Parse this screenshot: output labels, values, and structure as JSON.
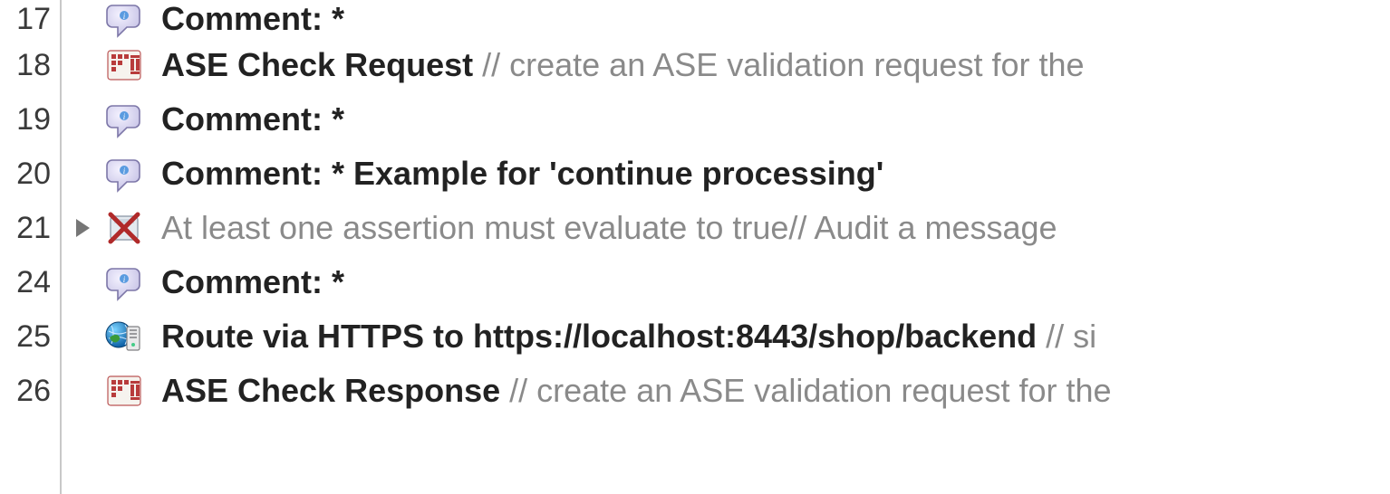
{
  "rows": [
    {
      "lineNumber": "17",
      "icon": "comment-bubble",
      "expand": false,
      "disabled": false,
      "label": "Comment: *",
      "tail": ""
    },
    {
      "lineNumber": "18",
      "icon": "ase-check",
      "expand": false,
      "disabled": false,
      "label": "ASE Check Request",
      "tail": "// create an ASE validation request for the"
    },
    {
      "lineNumber": "19",
      "icon": "comment-bubble",
      "expand": false,
      "disabled": false,
      "label": "Comment: *",
      "tail": ""
    },
    {
      "lineNumber": "20",
      "icon": "comment-bubble",
      "expand": false,
      "disabled": false,
      "label": "Comment: *  Example for 'continue processing'",
      "tail": ""
    },
    {
      "lineNumber": "21",
      "icon": "assertion-x",
      "expand": true,
      "disabled": true,
      "label": "At least one assertion must evaluate to true",
      "tail": "// Audit a message"
    },
    {
      "lineNumber": "24",
      "icon": "comment-bubble",
      "expand": false,
      "disabled": false,
      "label": "Comment: *",
      "tail": ""
    },
    {
      "lineNumber": "25",
      "icon": "route-https",
      "expand": false,
      "disabled": false,
      "label": "Route via HTTPS to https://localhost:8443/shop/backend",
      "tail": "// si"
    },
    {
      "lineNumber": "26",
      "icon": "ase-check",
      "expand": false,
      "disabled": false,
      "label": "ASE Check Response",
      "tail": "// create an ASE validation request for the"
    }
  ]
}
